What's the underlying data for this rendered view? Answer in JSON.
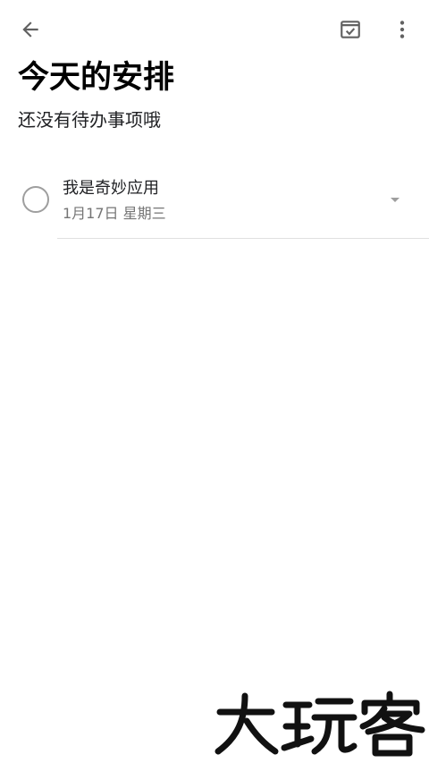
{
  "toolbar": {
    "back_icon": "arrow-back-icon",
    "done_icon": "calendar-check-icon",
    "menu_icon": "more-vertical-icon"
  },
  "header": {
    "title": "今天的安排",
    "subtitle": "还没有待办事项哦"
  },
  "tasks": [
    {
      "title": "我是奇妙应用",
      "date": "1月17日 星期三",
      "completed": false
    }
  ],
  "watermark": {
    "text": "大玩客"
  },
  "colors": {
    "background": "#ffffff",
    "icon": "#616161",
    "checkbox": "#9e9e9e",
    "secondary_text": "#757575",
    "divider": "#e0e0e0"
  }
}
